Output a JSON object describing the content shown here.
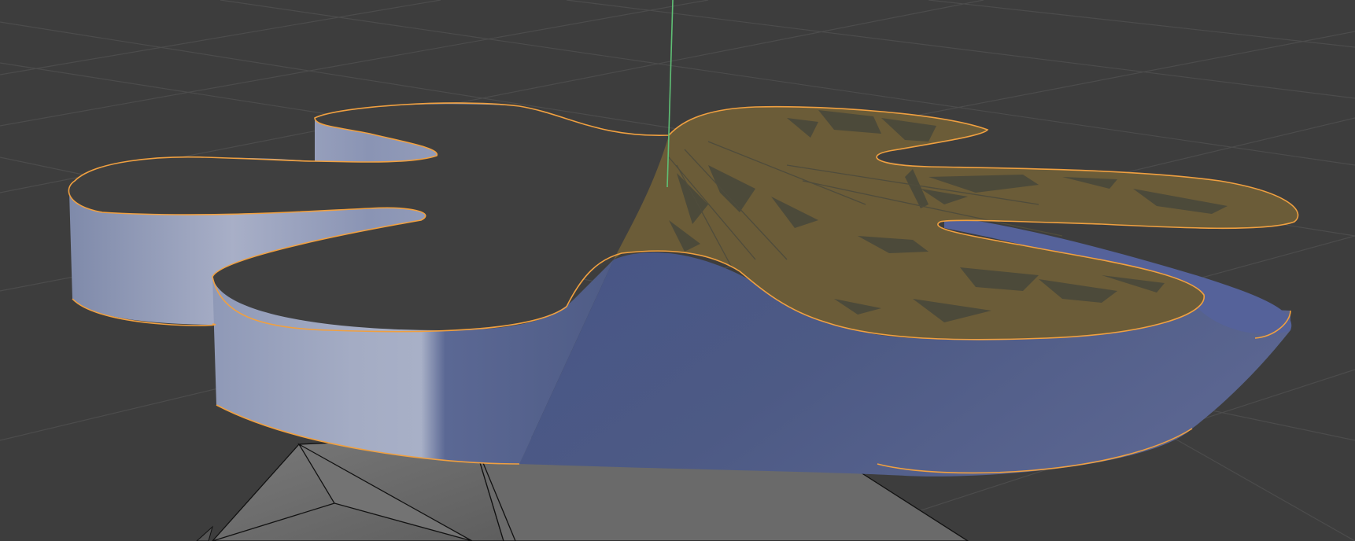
{
  "viewport": {
    "mode": "3d-perspective",
    "background_color": "#3d3d3d",
    "grid_line_color": "#4c4c4c"
  },
  "scene": {
    "objects": [
      {
        "name": "extruded-curve",
        "state": "selected",
        "outline_color": "#f0a040"
      },
      {
        "name": "polygon-object",
        "state": "unselected",
        "edge_color": "#111111"
      }
    ],
    "face_colors": {
      "front_wall": "#4e5b85",
      "back_wall": "#9aa3bf",
      "top_cap_selected": "#6b5c38",
      "shadow_artifacts": "#4a4838"
    },
    "axis": {
      "name": "y-axis",
      "color": "#5fbf75"
    }
  }
}
